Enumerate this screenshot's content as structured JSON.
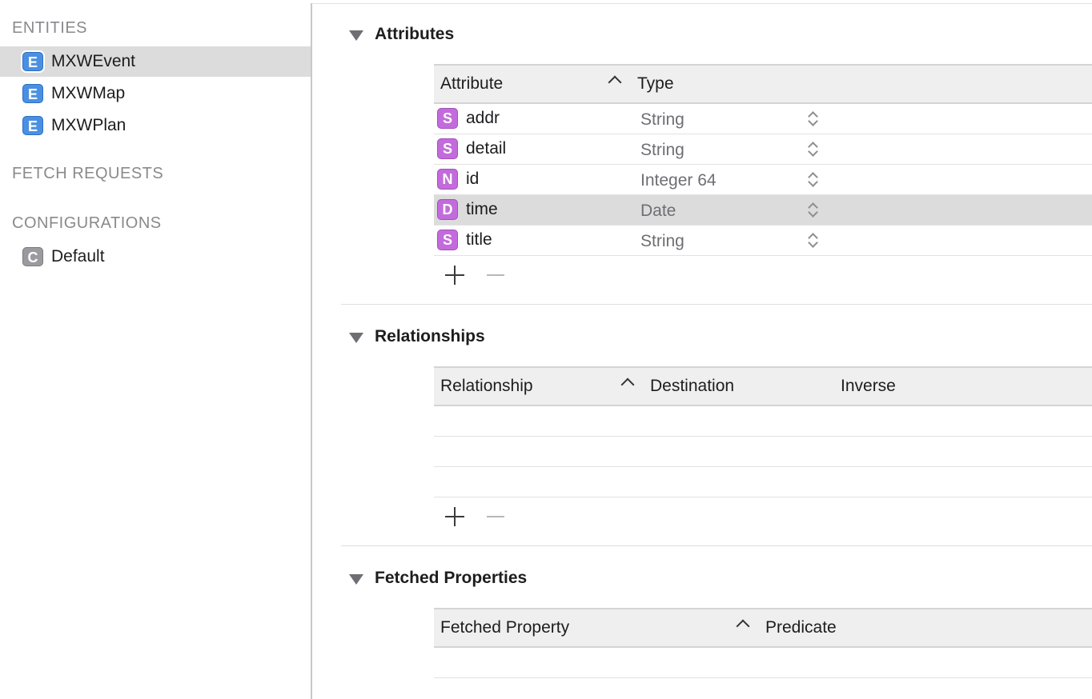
{
  "sidebar": {
    "entities_title": "ENTITIES",
    "entities": [
      {
        "badge": "E",
        "name": "MXWEvent",
        "selected": true
      },
      {
        "badge": "E",
        "name": "MXWMap",
        "selected": false
      },
      {
        "badge": "E",
        "name": "MXWPlan",
        "selected": false
      }
    ],
    "fetch_requests_title": "FETCH REQUESTS",
    "configurations_title": "CONFIGURATIONS",
    "configurations": [
      {
        "badge": "C",
        "name": "Default"
      }
    ]
  },
  "attributes": {
    "title": "Attributes",
    "columns": {
      "name": "Attribute",
      "type": "Type"
    },
    "rows": [
      {
        "badge": "S",
        "name": "addr",
        "type": "String",
        "selected": false
      },
      {
        "badge": "S",
        "name": "detail",
        "type": "String",
        "selected": false
      },
      {
        "badge": "N",
        "name": "id",
        "type": "Integer 64",
        "selected": false
      },
      {
        "badge": "D",
        "name": "time",
        "type": "Date",
        "selected": true
      },
      {
        "badge": "S",
        "name": "title",
        "type": "String",
        "selected": false
      }
    ]
  },
  "relationships": {
    "title": "Relationships",
    "columns": {
      "name": "Relationship",
      "destination": "Destination",
      "inverse": "Inverse"
    }
  },
  "fetched_properties": {
    "title": "Fetched Properties",
    "columns": {
      "name": "Fetched Property",
      "predicate": "Predicate"
    }
  },
  "colors": {
    "entity_badge": "#4a90e2",
    "attribute_badge": "#c36bdc",
    "config_badge": "#9b9b9f",
    "selection": "#dcdcdc"
  }
}
